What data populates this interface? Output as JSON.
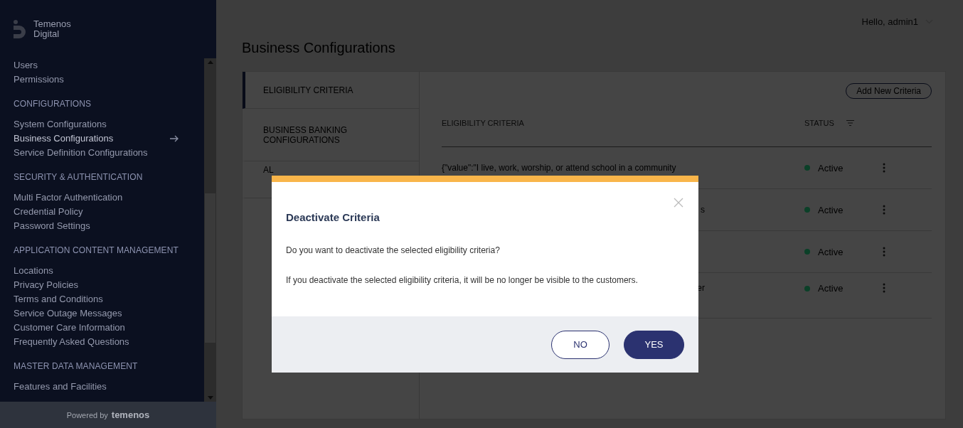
{
  "brand": {
    "name_line1": "Temenos",
    "name_line2": "Digital"
  },
  "sidebar": {
    "sections": [
      {
        "items": [
          {
            "label": "Users",
            "selected": false
          },
          {
            "label": "Permissions",
            "selected": false
          }
        ]
      },
      {
        "heading": "CONFIGURATIONS",
        "items": [
          {
            "label": "System Configurations",
            "selected": false
          },
          {
            "label": "Business Configurations",
            "selected": true
          },
          {
            "label": "Service Definition Configurations",
            "selected": false
          }
        ]
      },
      {
        "heading": "SECURITY & AUTHENTICATION",
        "items": [
          {
            "label": "Multi Factor Authentication",
            "selected": false
          },
          {
            "label": "Credential Policy",
            "selected": false
          },
          {
            "label": "Password Settings",
            "selected": false
          }
        ]
      },
      {
        "heading": "APPLICATION CONTENT MANAGEMENT",
        "items": [
          {
            "label": "Locations",
            "selected": false
          },
          {
            "label": "Privacy Policies",
            "selected": false
          },
          {
            "label": "Terms and Conditions",
            "selected": false
          },
          {
            "label": "Service Outage Messages",
            "selected": false
          },
          {
            "label": "Customer Care Information",
            "selected": false
          },
          {
            "label": "Frequently Asked Questions",
            "selected": false
          }
        ]
      },
      {
        "heading": "MASTER DATA MANAGEMENT",
        "items": [
          {
            "label": "Features and Facilities",
            "selected": false
          }
        ]
      }
    ],
    "footer": {
      "prefix": "Powered by",
      "logo": "temenos"
    }
  },
  "header": {
    "greeting": "Hello, admin1"
  },
  "page_title": "Business Configurations",
  "tabs": [
    {
      "label": "ELIGIBILITY CRITERIA",
      "selected": true
    },
    {
      "label": "BUSINESS BANKING CONFIGURATIONS",
      "selected": false
    },
    {
      "label": "AL",
      "selected": false
    }
  ],
  "add_button": "Add New Criteria",
  "table": {
    "columns": [
      "ELIGIBILITY CRITERIA",
      "STATUS"
    ],
    "rows": [
      {
        "criteria": "{\"value\":\"I live, work, worship, or attend school in a community",
        "kind": "full",
        "status": "Active",
        "color": "#0b4028"
      },
      {
        "criteria": "s",
        "kind": "fragment",
        "status": "Active",
        "color": "#0b4028"
      },
      {
        "status": "Active",
        "kind": "fragment",
        "color": "#0b4028"
      },
      {
        "criteria": "er",
        "kind": "fragment",
        "status": "Active",
        "color": "#0b4028"
      }
    ]
  },
  "dialog": {
    "title": "Deactivate Criteria",
    "question": "Do you want to deactivate the selected eligibility criteria?",
    "warning": "If you deactivate the selected eligibility criteria, it will be no longer be visible to the customers.",
    "buttons": [
      {
        "label": "NO",
        "kind": "secondary"
      },
      {
        "label": "YES",
        "kind": "primary"
      }
    ]
  }
}
